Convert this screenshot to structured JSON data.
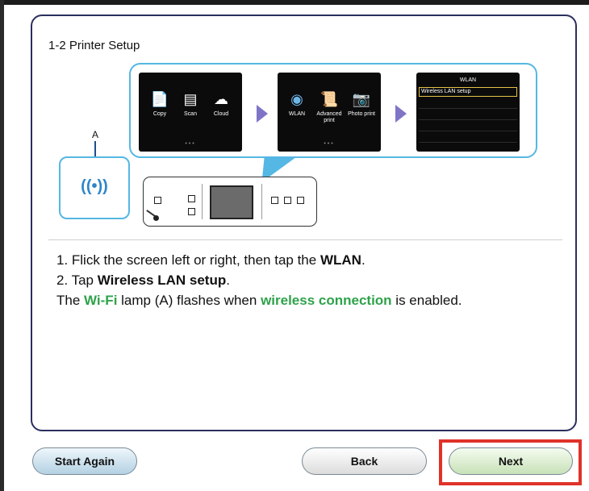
{
  "page": {
    "title": "1-2 Printer Setup"
  },
  "screens": [
    {
      "apps": [
        {
          "label": "Copy",
          "icon": "copy-icon"
        },
        {
          "label": "Scan",
          "icon": "scan-icon"
        },
        {
          "label": "Cloud",
          "icon": "cloud-icon"
        }
      ]
    },
    {
      "apps": [
        {
          "label": "WLAN",
          "icon": "wlan-icon"
        },
        {
          "label": "Advanced print",
          "icon": "advanced-print-icon"
        },
        {
          "label": "Photo print",
          "icon": "photo-print-icon"
        }
      ]
    },
    {
      "title": "WLAN",
      "item": "Wireless LAN setup"
    }
  ],
  "illustration": {
    "marker": "A"
  },
  "instructions": {
    "step1_pre": "1. Flick the screen left or right, then tap the ",
    "step1_bold": "WLAN",
    "step1_post": ".",
    "step2_pre": "2. Tap ",
    "step2_bold": "Wireless LAN setup",
    "step2_post": ".",
    "note_pre": "The ",
    "note_wifi": "Wi-Fi",
    "note_mid": " lamp (A) flashes when ",
    "note_green": "wireless connection",
    "note_post": " is enabled."
  },
  "buttons": {
    "start_again": "Start Again",
    "back": "Back",
    "next": "Next"
  },
  "colors": {
    "accent_blue": "#55b7e3",
    "highlight_green": "#2ea24a",
    "next_outline": "#e0322a",
    "arrow": "#7f75c7"
  }
}
